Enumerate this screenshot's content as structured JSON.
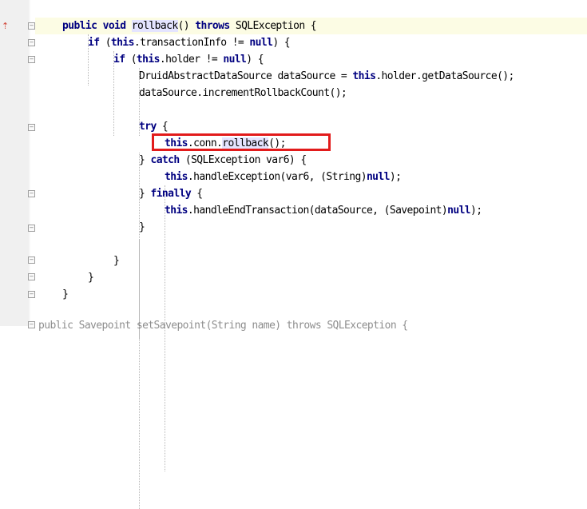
{
  "gutter": {
    "icons": [
      {
        "name": "override-method-icon",
        "glyph": "⇡"
      }
    ]
  },
  "code": {
    "lines": [
      {
        "tokens": [
          {
            "t": "public ",
            "k": "kw"
          },
          {
            "t": "void ",
            "k": "kw"
          },
          {
            "t": "rollback",
            "k": "hl"
          },
          {
            "t": "() ",
            "k": ""
          },
          {
            "t": "throws ",
            "k": "kw"
          },
          {
            "t": "SQLException {",
            "k": ""
          }
        ]
      },
      {
        "tokens": [
          {
            "t": "if ",
            "k": "kw"
          },
          {
            "t": "(",
            "k": ""
          },
          {
            "t": "this",
            "k": "kw"
          },
          {
            "t": ".transactionInfo != ",
            "k": ""
          },
          {
            "t": "null",
            "k": "kw"
          },
          {
            "t": ") {",
            "k": ""
          }
        ]
      },
      {
        "tokens": [
          {
            "t": "if ",
            "k": "kw"
          },
          {
            "t": "(",
            "k": ""
          },
          {
            "t": "this",
            "k": "kw"
          },
          {
            "t": ".holder != ",
            "k": ""
          },
          {
            "t": "null",
            "k": "kw"
          },
          {
            "t": ") {",
            "k": ""
          }
        ]
      },
      {
        "tokens": [
          {
            "t": "DruidAbstractDataSource dataSource = ",
            "k": ""
          },
          {
            "t": "this",
            "k": "kw"
          },
          {
            "t": ".holder.getDataSource();",
            "k": ""
          }
        ]
      },
      {
        "tokens": [
          {
            "t": "dataSource.incrementRollbackCount();",
            "k": ""
          }
        ]
      },
      {
        "tokens": []
      },
      {
        "tokens": [
          {
            "t": "try ",
            "k": "kw"
          },
          {
            "t": "{",
            "k": ""
          }
        ]
      },
      {
        "tokens": [
          {
            "t": "this",
            "k": "kw"
          },
          {
            "t": ".conn.",
            "k": ""
          },
          {
            "t": "rollback",
            "k": "hl"
          },
          {
            "t": "();",
            "k": ""
          }
        ]
      },
      {
        "tokens": [
          {
            "t": "} ",
            "k": ""
          },
          {
            "t": "catch ",
            "k": "kw"
          },
          {
            "t": "(SQLException var6) {",
            "k": ""
          }
        ]
      },
      {
        "tokens": [
          {
            "t": "this",
            "k": "kw"
          },
          {
            "t": ".handleException(var6, (String)",
            "k": ""
          },
          {
            "t": "null",
            "k": "kw"
          },
          {
            "t": ");",
            "k": ""
          }
        ]
      },
      {
        "tokens": [
          {
            "t": "} ",
            "k": ""
          },
          {
            "t": "finally ",
            "k": "kw"
          },
          {
            "t": "{",
            "k": ""
          }
        ]
      },
      {
        "tokens": [
          {
            "t": "this",
            "k": "kw"
          },
          {
            "t": ".handleEndTransaction(dataSource, (Savepoint)",
            "k": ""
          },
          {
            "t": "null",
            "k": "kw"
          },
          {
            "t": ");",
            "k": ""
          }
        ]
      },
      {
        "tokens": [
          {
            "t": "}",
            "k": ""
          }
        ]
      },
      {
        "tokens": []
      },
      {
        "tokens": [
          {
            "t": "}",
            "k": ""
          }
        ]
      },
      {
        "tokens": [
          {
            "t": "}",
            "k": ""
          }
        ]
      },
      {
        "tokens": [
          {
            "t": "}",
            "k": ""
          }
        ]
      }
    ],
    "partial_next_line": "public Savepoint setSavepoint(String name) throws SQLException {"
  },
  "annotation": {
    "color": "#e21b1b",
    "target": "this.conn.rollback();"
  }
}
